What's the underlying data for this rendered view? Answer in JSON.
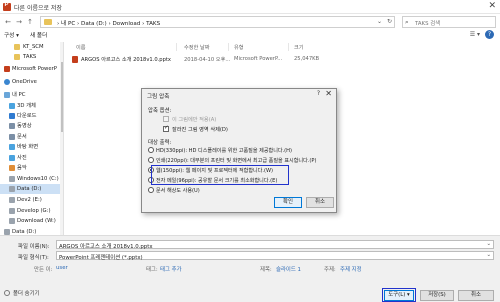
{
  "window": {
    "title": "다른 이름으로 저장",
    "close_glyph": "✕"
  },
  "address": {
    "path": "›  내 PC  ›  Data (D:)  ›  Download  ›  TAKS",
    "search_placeholder": "TAKS 검색"
  },
  "toolbar": {
    "organize": "구성 ▾",
    "new_folder": "새 폴더"
  },
  "sidebar": {
    "items": [
      {
        "label": "KT_SCM",
        "icon": "folder-icon"
      },
      {
        "label": "TAKS",
        "icon": "folder-icon"
      },
      {
        "label": "Microsoft PowerP",
        "icon": "powerpoint-icon"
      },
      {
        "label": "OneDrive",
        "icon": "cloud-icon"
      },
      {
        "label": "내 PC",
        "icon": "pc-icon"
      },
      {
        "label": "3D 개체",
        "icon": "3d-objects-icon"
      },
      {
        "label": "다운로드",
        "icon": "download-icon"
      },
      {
        "label": "동영상",
        "icon": "video-icon"
      },
      {
        "label": "문서",
        "icon": "document-icon"
      },
      {
        "label": "바탕 화면",
        "icon": "desktop-icon"
      },
      {
        "label": "사진",
        "icon": "pictures-icon"
      },
      {
        "label": "음악",
        "icon": "music-icon"
      },
      {
        "label": "Windows10 (C:)",
        "icon": "drive-icon"
      },
      {
        "label": "Data (D:)",
        "icon": "drive-icon",
        "selected": true
      },
      {
        "label": "Dev2 (E:)",
        "icon": "drive-icon"
      },
      {
        "label": "Develop (G:)",
        "icon": "drive-icon"
      },
      {
        "label": "Download (W:)",
        "icon": "drive-icon"
      },
      {
        "label": "Data (D:)",
        "icon": "drive-icon"
      }
    ]
  },
  "filelist": {
    "headers": {
      "name": "이름",
      "date": "수정한 날짜",
      "type": "유형",
      "size": "크기"
    },
    "rows": [
      {
        "name": "ARGOS 아르고스 소개 2018v1.0.pptx",
        "date": "2018-04-10 오후...",
        "type": "Microsoft PowerP...",
        "size": "25,047KB"
      }
    ]
  },
  "bottom": {
    "filename_label": "파일 이름(N):",
    "filename_value": "ARGOS 아르고스 소개 2018v1.0.pptx",
    "filetype_label": "파일 형식(T):",
    "filetype_value": "PowerPoint 프레젠테이션 (*.pptx)",
    "author_label": "만든 이:",
    "author_value": "user",
    "tags_label": "태그:",
    "tags_value": "태그 추가",
    "title_label": "제목:",
    "title_value": "슬라이드 1",
    "subject_label": "주제:",
    "subject_value": "주제 지정",
    "hide_folders": "폴더 숨기기",
    "tools_button": "도구(L) ▾",
    "save_button": "저장(S)",
    "cancel_button": "취소"
  },
  "dialog": {
    "title": "그림 압축",
    "help_glyph": "?",
    "close_glyph": "✕",
    "compress_options_label": "압축 옵션:",
    "apply_only_this": "이 그림에만 적용(A)",
    "delete_cropped": "잘라진 그림 영역 삭제(D)",
    "target_output_label": "대상 출력:",
    "radios": [
      {
        "label": "HD(330ppi): HD 디스플레이를 위한 고품질을 제공합니다.(H)",
        "checked": false
      },
      {
        "label": "인쇄(220ppi): 대부분의 프린터 및 화면에서 최고급 품질을 표시합니다.(P)",
        "checked": false
      },
      {
        "label": "웹(150ppi): 웹 페이지 및 프로젝터에 적합합니다.(W)",
        "checked": true
      },
      {
        "label": "전자 메일(96ppi): 공유할 문서 크기를 최소화합니다.(E)",
        "checked": false
      },
      {
        "label": "문서 해상도 사용(U)",
        "checked": false
      }
    ],
    "ok": "확인",
    "cancel": "취소"
  }
}
